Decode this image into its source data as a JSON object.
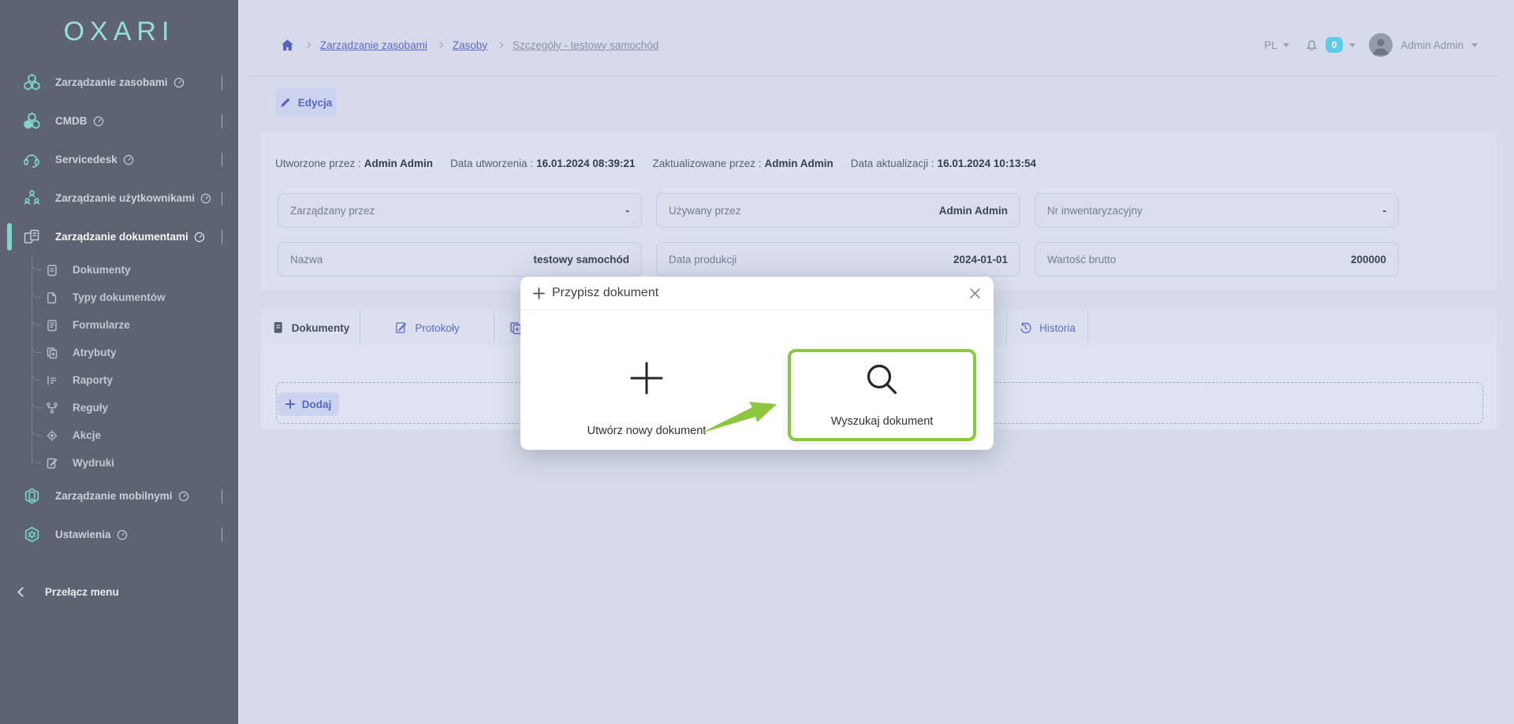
{
  "sidebar": {
    "logo": "OXARI",
    "items": [
      {
        "label": "Zarządzanie zasobami"
      },
      {
        "label": "CMDB"
      },
      {
        "label": "Servicedesk"
      },
      {
        "label": "Zarządzanie użytkownikami"
      },
      {
        "label": "Zarządzanie dokumentami",
        "children": [
          "Dokumenty",
          "Typy dokumentów",
          "Formularze",
          "Atrybuty",
          "Raporty",
          "Reguły",
          "Akcje",
          "Wydruki"
        ]
      },
      {
        "label": "Zarządzanie mobilnymi"
      },
      {
        "label": "Ustawienia"
      }
    ],
    "toggle_label": "Przełącz menu"
  },
  "header": {
    "breadcrumb": [
      "Zarządzanie zasobami",
      "Zasoby",
      "Szczegóły - testowy samochód"
    ],
    "language": "PL",
    "notifications_count": "0",
    "user_name": "Admin Admin"
  },
  "toolbar": {
    "edit_label": "Edycja"
  },
  "meta": [
    {
      "label": "Utworzone przez :",
      "value": "Admin Admin"
    },
    {
      "label": "Data utworzenia :",
      "value": "16.01.2024 08:39:21"
    },
    {
      "label": "Zaktualizowane przez :",
      "value": "Admin Admin"
    },
    {
      "label": "Data aktualizacji :",
      "value": "16.01.2024 10:13:54"
    }
  ],
  "fields": [
    {
      "label": "Zarządzany przez",
      "value": "-"
    },
    {
      "label": "Używany przez",
      "value": "Admin Admin"
    },
    {
      "label": "Nr inwentaryzacyjny",
      "value": "-"
    },
    {
      "label": "Nazwa",
      "value": "testowy samochód"
    },
    {
      "label": "Data produkcji",
      "value": "2024-01-01"
    },
    {
      "label": "Wartość brutto",
      "value": "200000"
    }
  ],
  "tabs": {
    "active": "Dokumenty",
    "items": [
      {
        "label": "Dokumenty"
      },
      {
        "label": "Protokoły"
      },
      {
        "label": "Historia"
      }
    ]
  },
  "content": {
    "add_label": "Dodaj"
  },
  "modal": {
    "title": "Przypisz dokument",
    "options": [
      {
        "label": "Utwórz nowy dokument",
        "highlighted": false
      },
      {
        "label": "Wyszukaj dokument",
        "highlighted": true
      }
    ]
  },
  "colors": {
    "sidebar_bg": "#5d6371",
    "page_bg": "#d6daea",
    "teal_accent": "#7fd4d2",
    "blue_accent": "#5f6cc4",
    "lime_highlight": "#8dc63f",
    "badge_cyan": "#5ecbe9"
  }
}
